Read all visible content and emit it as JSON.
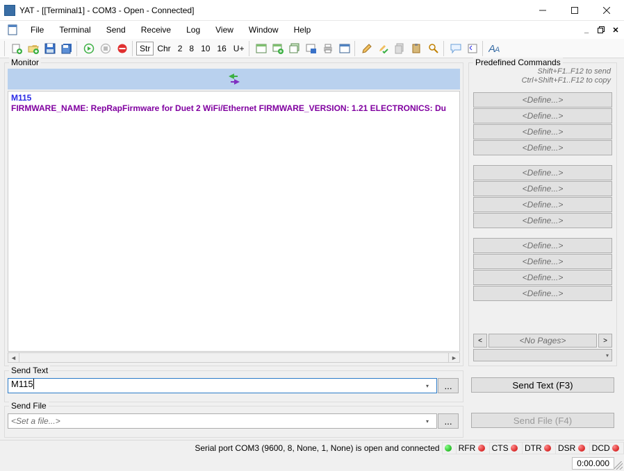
{
  "window": {
    "title": "YAT - [[Terminal1] - COM3 - Open - Connected]"
  },
  "menu": {
    "file": "File",
    "terminal": "Terminal",
    "send": "Send",
    "receive": "Receive",
    "log": "Log",
    "view": "View",
    "window": "Window",
    "help": "Help"
  },
  "toolbar": {
    "radix_str": "Str",
    "radix_chr": "Chr",
    "n2": "2",
    "n8": "8",
    "n10": "10",
    "n16": "16",
    "uplus": "U+"
  },
  "monitor": {
    "caption": "Monitor",
    "cmd": "M115",
    "resp": "FIRMWARE_NAME: RepRapFirmware for Duet 2 WiFi/Ethernet FIRMWARE_VERSION: 1.21 ELECTRONICS: Du"
  },
  "predef": {
    "caption": "Predefined Commands",
    "hint1": "Shift+F1..F12 to send",
    "hint2": "Ctrl+Shift+F1..F12 to copy",
    "btn": "<Define...>",
    "no_pages": "<No Pages>"
  },
  "sendtext": {
    "caption": "Send Text",
    "value": "M115",
    "button": "Send Text (F3)"
  },
  "sendfile": {
    "caption": "Send File",
    "placeholder": "<Set a file...>",
    "button": "Send File (F4)"
  },
  "status": {
    "msg": "Serial port COM3 (9600, 8, None, 1, None) is open and connected",
    "sig_rfr": "RFR",
    "sig_cts": "CTS",
    "sig_dtr": "DTR",
    "sig_dsr": "DSR",
    "sig_dcd": "DCD",
    "timer": "0:00.000"
  }
}
